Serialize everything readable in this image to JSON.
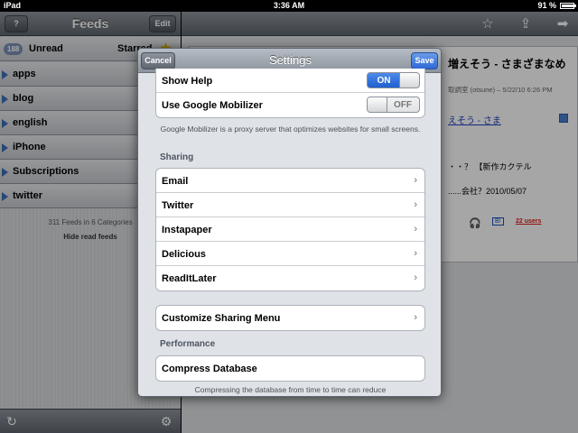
{
  "status_bar": {
    "device": "iPad",
    "time": "3:36 AM",
    "battery": "91 %",
    "battery_level": 0.91
  },
  "feeds_pane": {
    "title": "Feeds",
    "help_button": "?",
    "edit_button": "Edit",
    "unread": {
      "count": "188",
      "label": "Unread",
      "starred_label": "Starred"
    },
    "folders": [
      "apps",
      "blog",
      "english",
      "iPhone",
      "Subscriptions",
      "twitter"
    ],
    "summary": "311 Feeds in 6 Categories",
    "hide_read": "Hide read feeds"
  },
  "article": {
    "title": "増えそう - さまざまなめ",
    "meta": "取調室 (otsune) – 5/22/10 6:26 PM",
    "link": "えそう - さま",
    "line1": "・・？ 【新作カクテル",
    "line2": "......会社？2010/05/07",
    "users": "22 users",
    "b_badge": "B!"
  },
  "settings": {
    "title": "Settings",
    "cancel": "Cancel",
    "save": "Save",
    "show_help": {
      "label": "Show Help",
      "state": "ON"
    },
    "google_mobilizer": {
      "label": "Use Google Mobilizer",
      "state": "OFF"
    },
    "mobilizer_note": "Google Mobilizer is a proxy server that optimizes websites for small screens.",
    "sharing_header": "Sharing",
    "sharing_items": [
      "Email",
      "Twitter",
      "Instapaper",
      "Delicious",
      "ReadItLater"
    ],
    "customize_sharing": "Customize Sharing Menu",
    "performance_header": "Performance",
    "compress_db": "Compress Database",
    "compress_note": "Compressing the database from time to time can reduce"
  }
}
